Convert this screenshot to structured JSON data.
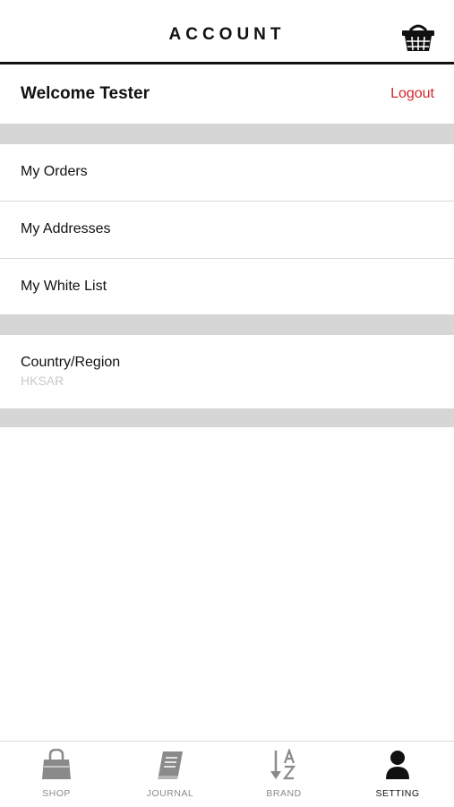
{
  "header": {
    "title": "ACCOUNT",
    "cart_icon": "shopping-basket-icon"
  },
  "welcome": {
    "text": "Welcome Tester",
    "logout_label": "Logout",
    "logout_color": "#d0262b"
  },
  "menu": {
    "items": [
      {
        "label": "My Orders"
      },
      {
        "label": "My Addresses"
      },
      {
        "label": "My White List"
      }
    ]
  },
  "region": {
    "label": "Country/Region",
    "value": "HKSAR"
  },
  "tabbar": {
    "tabs": [
      {
        "label": "SHOP",
        "icon": "shopping-bag-icon",
        "active": false
      },
      {
        "label": "JOURNAL",
        "icon": "book-icon",
        "active": false
      },
      {
        "label": "BRAND",
        "icon": "sort-az-icon",
        "active": false
      },
      {
        "label": "SETTING",
        "icon": "person-icon",
        "active": true
      }
    ]
  },
  "colors": {
    "accent": "#d0262b",
    "section_gap": "#d6d6d6",
    "inactive_tab": "#8a8a8a"
  }
}
